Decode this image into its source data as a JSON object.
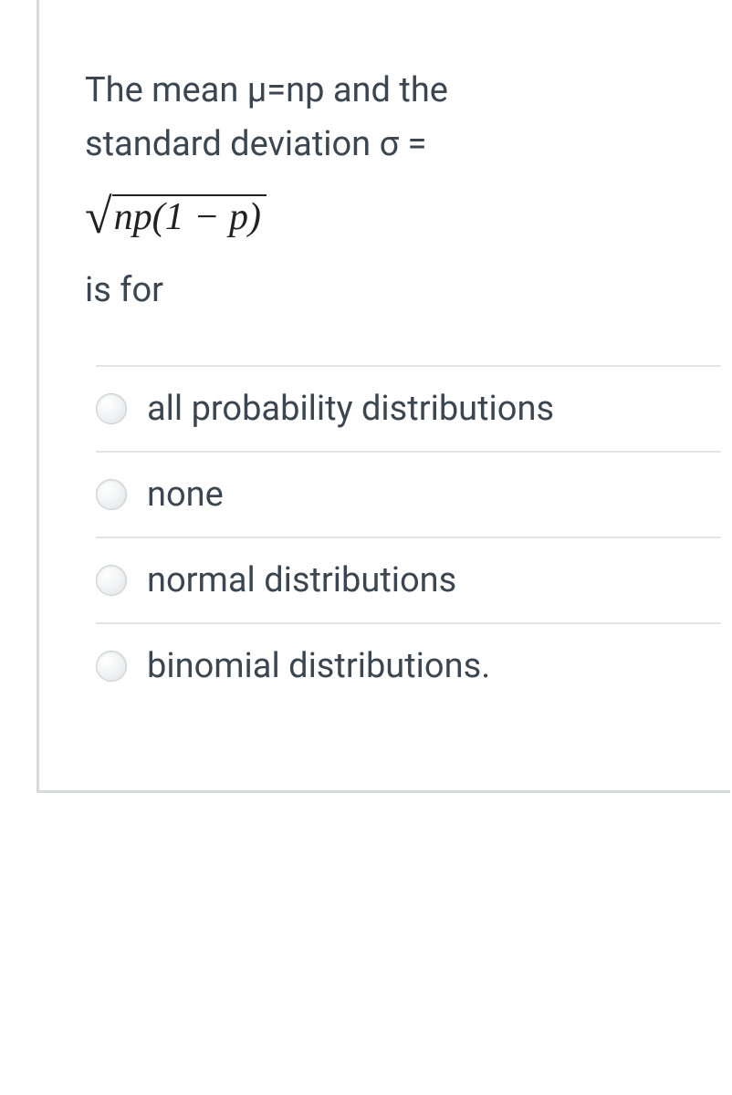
{
  "question": {
    "line1": "The mean μ=np and the",
    "line2": "standard deviation  σ =",
    "formula_radicand": "np(1 − p)",
    "isfor": "is for"
  },
  "options": [
    {
      "label": "all probability distributions"
    },
    {
      "label": "none"
    },
    {
      "label": "normal distributions"
    },
    {
      "label": "binomial distributions."
    }
  ]
}
